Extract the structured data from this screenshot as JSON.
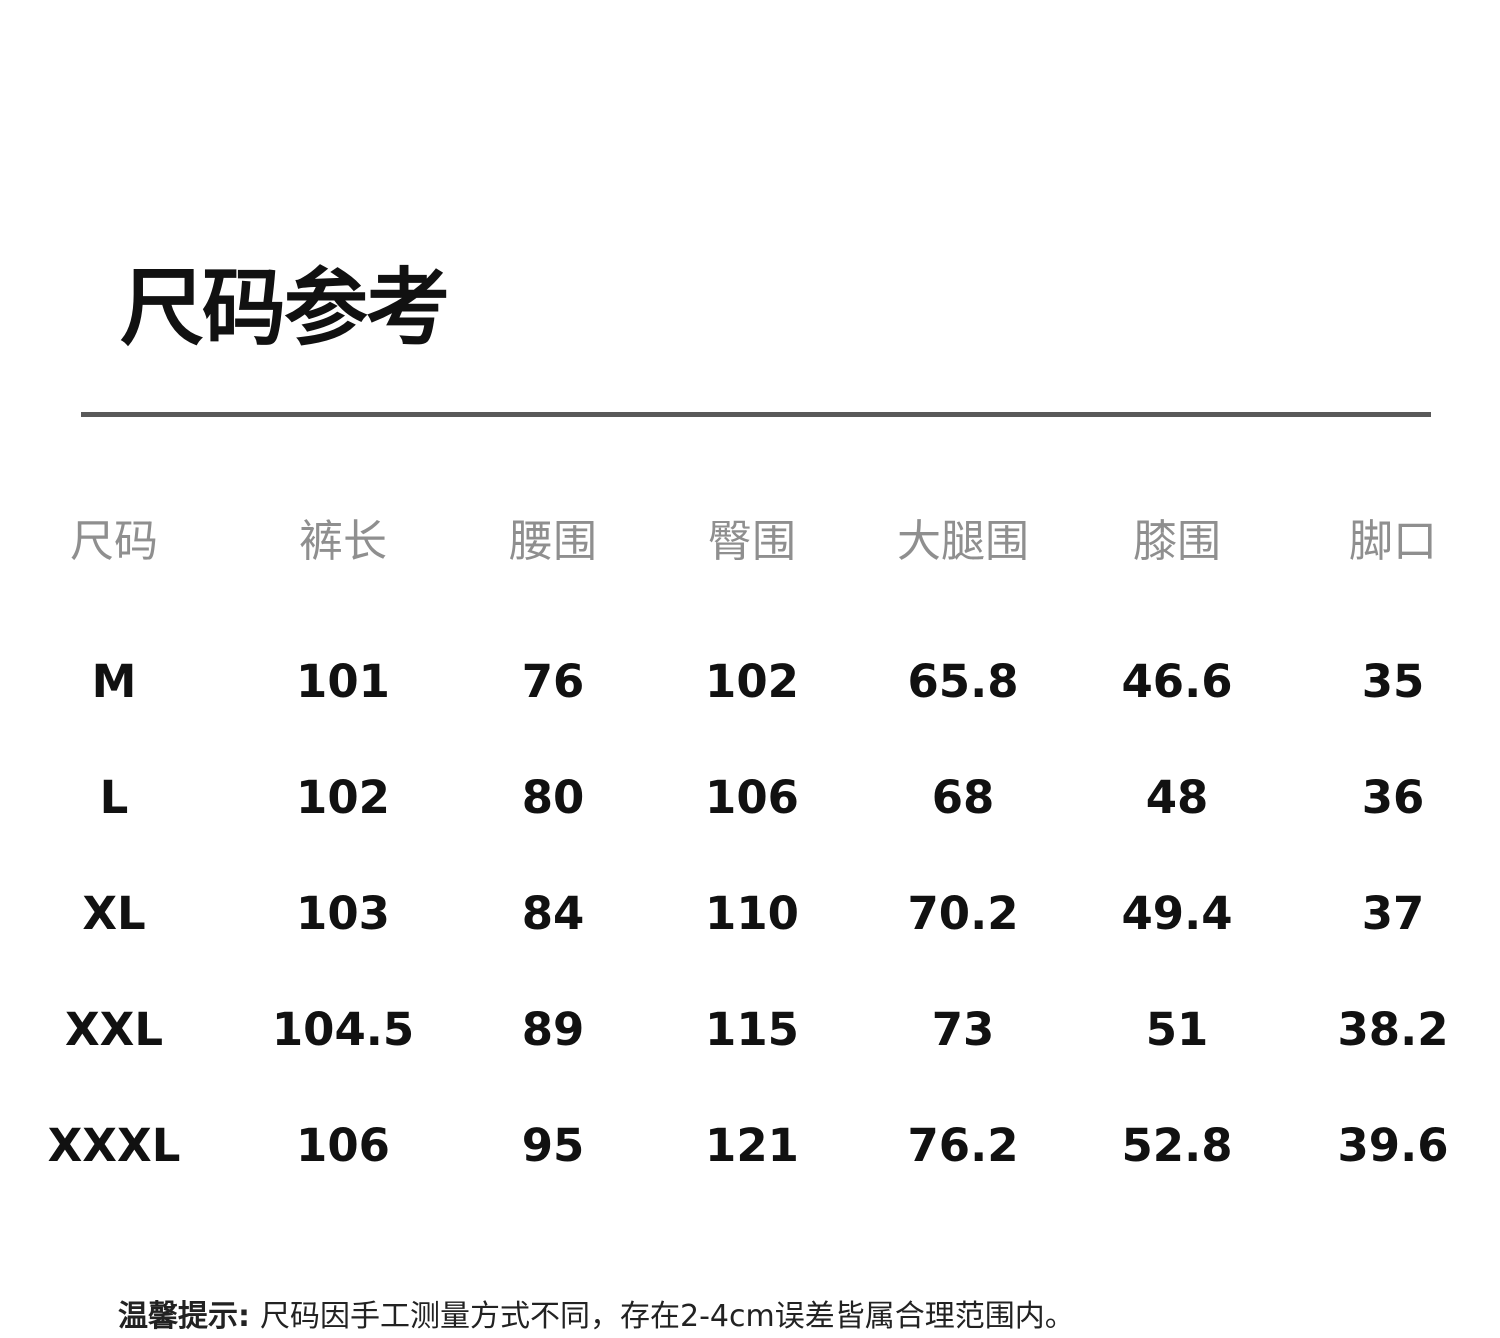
{
  "title": "尺码参考",
  "table": {
    "headers": [
      "尺码",
      "裤长",
      "腰围",
      "臀围",
      "大腿围",
      "膝围",
      "脚口"
    ],
    "rows": [
      [
        "M",
        "101",
        "76",
        "102",
        "65.8",
        "46.6",
        "35"
      ],
      [
        "L",
        "102",
        "80",
        "106",
        "68",
        "48",
        "36"
      ],
      [
        "XL",
        "103",
        "84",
        "110",
        "70.2",
        "49.4",
        "37"
      ],
      [
        "XXL",
        "104.5",
        "89",
        "115",
        "73",
        "51",
        "38.2"
      ],
      [
        "XXXL",
        "106",
        "95",
        "121",
        "76.2",
        "52.8",
        "39.6"
      ]
    ]
  },
  "footer": {
    "label": "温馨提示:",
    "text": "尺码因手工测量方式不同，存在2-4cm误差皆属合理范围内。"
  },
  "colors": {
    "title": "#111111",
    "divider": "#595959",
    "header_text": "#8f8f8f",
    "value_text": "#111111"
  }
}
